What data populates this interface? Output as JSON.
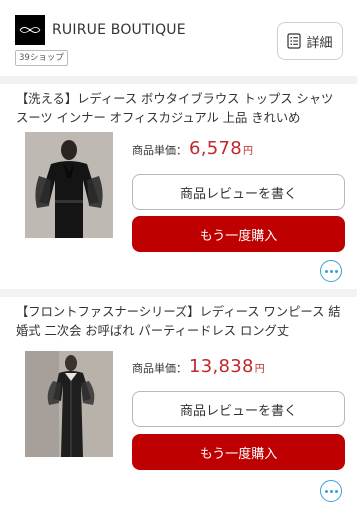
{
  "shop": {
    "name": "RUIRUE BOUTIQUE",
    "badge": "39ショップ",
    "detail_label": "詳細",
    "logo_icon": "shop-logo-icon",
    "detail_icon": "list-document-icon"
  },
  "orders": [
    {
      "title": "【洗える】レディース ボウタイブラウス トップス シャツ スーツ インナー オフィスカジュアル 上品 きれいめ",
      "price_label": "商品単価：",
      "price": "6,578",
      "price_unit": "円",
      "review_label": "商品レビューを書く",
      "rebuy_label": "もう一度購入",
      "more_icon": "more-dots-icon"
    },
    {
      "title": "【フロントファスナーシリーズ】レディース ワンピース 結婚式 二次会 お呼ばれ パーティードレス ロング丈",
      "price_label": "商品単価：",
      "price": "13,838",
      "price_unit": "円",
      "review_label": "商品レビューを書く",
      "rebuy_label": "もう一度購入",
      "more_icon": "more-dots-icon"
    }
  ],
  "colors": {
    "price": "#c0282d",
    "rebuy_button": "#bf0000",
    "more_accent": "#3aa0d8",
    "background": "#f2f2f2"
  }
}
